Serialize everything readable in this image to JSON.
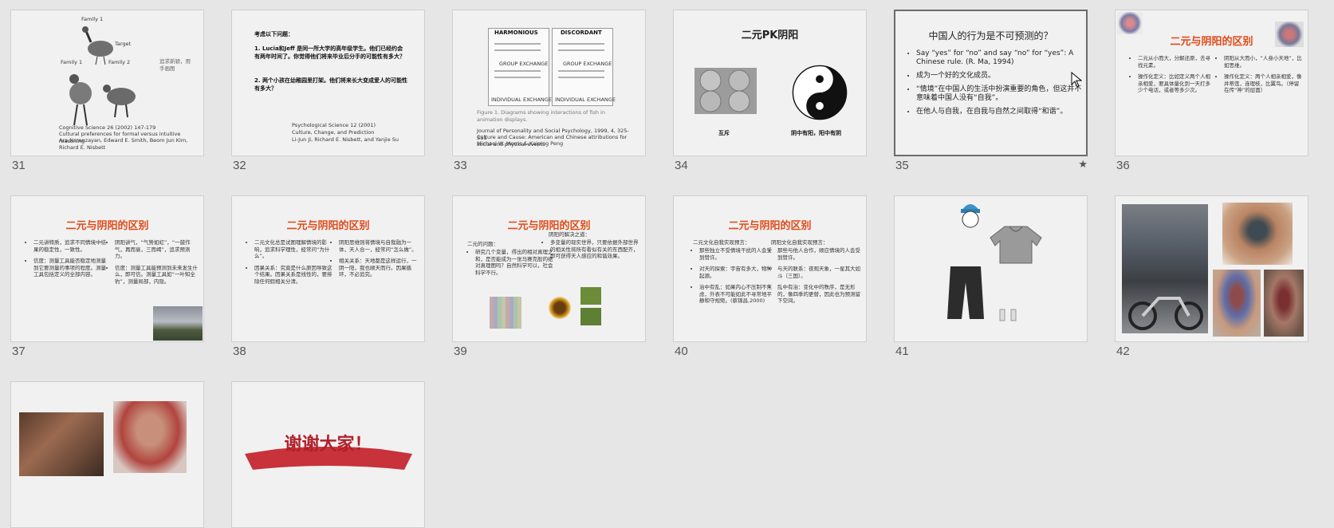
{
  "slides": [
    {
      "number": "31",
      "notes_text": "追求新颖，用手画图",
      "caption_lines": [
        "Cognitive Science 26 (2002) 147-179",
        "Cultural preferences for formal versus intuitive reasoning",
        "Ara Norenzayan, Edward E. Smith, Beom Jun Kim, Richard E. Nisbett"
      ],
      "labels": [
        "Family 1",
        "Family 2",
        "Target"
      ]
    },
    {
      "number": "32",
      "heading": "考虑以下问题：",
      "q1": "1. Lucia和Jeff 是同一所大学的高年级学生。他们已经约会有两年时间了。你觉得他们将来毕业后分手的可能性有多大？",
      "q2": "2. 两个小孩在幼稚园里打架。他们将来长大变成爱人的可能性有多大？",
      "ref": [
        "Psychological Science 12 (2001)",
        "Culture, Change, and Prediction",
        "Li-Jun Ji, Richard E. Nisbett, and Yanjie Su"
      ]
    },
    {
      "number": "33",
      "header_left": "HARMONIOUS",
      "header_right": "DISCORDANT",
      "sub_left": "GROUP EXCHANGE",
      "sub_right": "GROUP EXCHANGE",
      "foot_left": "INDIVIDUAL EXCHANGE",
      "foot_right": "INDIVIDUAL EXCHANGE",
      "caption": "Figure 1. Diagrams showing interactions of fish in animation displays.",
      "ref": [
        "Journal of Personality and Social Psychology, 1999, 4, 325-351",
        "Culture and Cause: American and Chinese attributions for social and physical events",
        "Michael W. Morris & Kaiping Peng"
      ]
    },
    {
      "number": "34",
      "title": "二元PK阴阳",
      "left_label": "互斥",
      "right_label": "阴中有阳，阳中有阴"
    },
    {
      "number": "35",
      "title": "中国人的行为是不可预测的？",
      "bullets": [
        "Say “yes” for “no” and say “no” for “yes”: A Chinese rule. (R. Ma, 1994)",
        "成为一个好的文化成员。",
        "“情境”在中国人的生活中扮演重要的角色，但这并不意味着中国人没有“自我”。",
        "在他人与自我，在自我与自然之间取得“和谐”。"
      ],
      "star": "★"
    },
    {
      "number": "36",
      "title": "二元与阴阳的区别",
      "left": [
        "二元从小而大，分解还原，去寻找元素。",
        "操作化定义：比如定义两个人相亲相爱，要具体量化到一天打多少个电话，或者等多少次。"
      ],
      "right": [
        "阴阳从大而小，“人身小天地”，比如思维。",
        "操作化定义：两个人相亲相爱，像并蒂莲，连理枝，比翼鸟。（停留在传“神”的层面）"
      ]
    },
    {
      "number": "37",
      "title": "二元与阴阳的区别",
      "left": [
        "二元讲特质，追求不同情境中结果的稳定性，一致性。",
        "信度：测量工具能否稳定地测量到它要测量的事项的程度。测量工具包括定义的全部内容。"
      ],
      "right": [
        "阴阳讲气，“气势如虹”，“一鼓作气，再而衰，三而竭”，追求预测力。",
        "信度：测量工具能预测到未来发生什么，即可信。测量工具如“一叶知全豹”，测量局部，内隐。"
      ]
    },
    {
      "number": "38",
      "title": "二元与阴阳的区别",
      "left": [
        "二元文化总是试图理解情境的影响，追求科学理性，经常问“为什么”。",
        "因果关系：究竟是什么原因导致这个结果。因果关系是线性的，要排除任何假相关分清。"
      ],
      "right": [
        "阴阳思维则将情境与自我融为一体，天人合一，经常问“怎么做”。",
        "相关关系：天地都是这样运行，一阴一阳，我也顺天而行。因果循环，不必追究。"
      ]
    },
    {
      "number": "39",
      "title": "二元与阴阳的区别",
      "left_head": "二元的问题：",
      "left": [
        "研究几个变量，得出的相对真理之和，是否能成为一张马赛克般的绝对真理图吗？自然科学可以，社会科学不行。"
      ],
      "right_head": "阴阳的解决之道：",
      "right": [
        "多变量的现实世界，只要依据外部世界的相关性将所有看似有关的东西配齐，即可获得天人感应的和谐效果。"
      ]
    },
    {
      "number": "40",
      "title": "二元与阴阳的区别",
      "left_head": "二元文化自我实现预言：",
      "left": [
        "那些独立不受情境干扰的人会受到赞许。",
        "对天的探索：宇宙有多大，物种起源。",
        "治中有乱：如果内心不压制不焦虑，外表不可能如此不寻常地平静和守规矩。(蔡锦昌,2000)"
      ],
      "right_head": "阴阳文化自我实现预言：",
      "right": [
        "那些与他人合作，顺应情境的人会受到赞许。",
        "与天的联系：夜观天象，一星其大如斗（三国）。",
        "乱中有治：变化中的秩序，是无形的，像四季的更替，因此也为预测留下空间。"
      ]
    },
    {
      "number": "41"
    },
    {
      "number": "42"
    },
    {
      "number": "43"
    },
    {
      "number": "44",
      "banner_text": "谢谢大家！"
    }
  ],
  "colors": {
    "background": "#e6e6e6",
    "slide_bg": "#f1f1f1",
    "title_accent": "#e04a18",
    "ribbon": "#c8323a"
  }
}
